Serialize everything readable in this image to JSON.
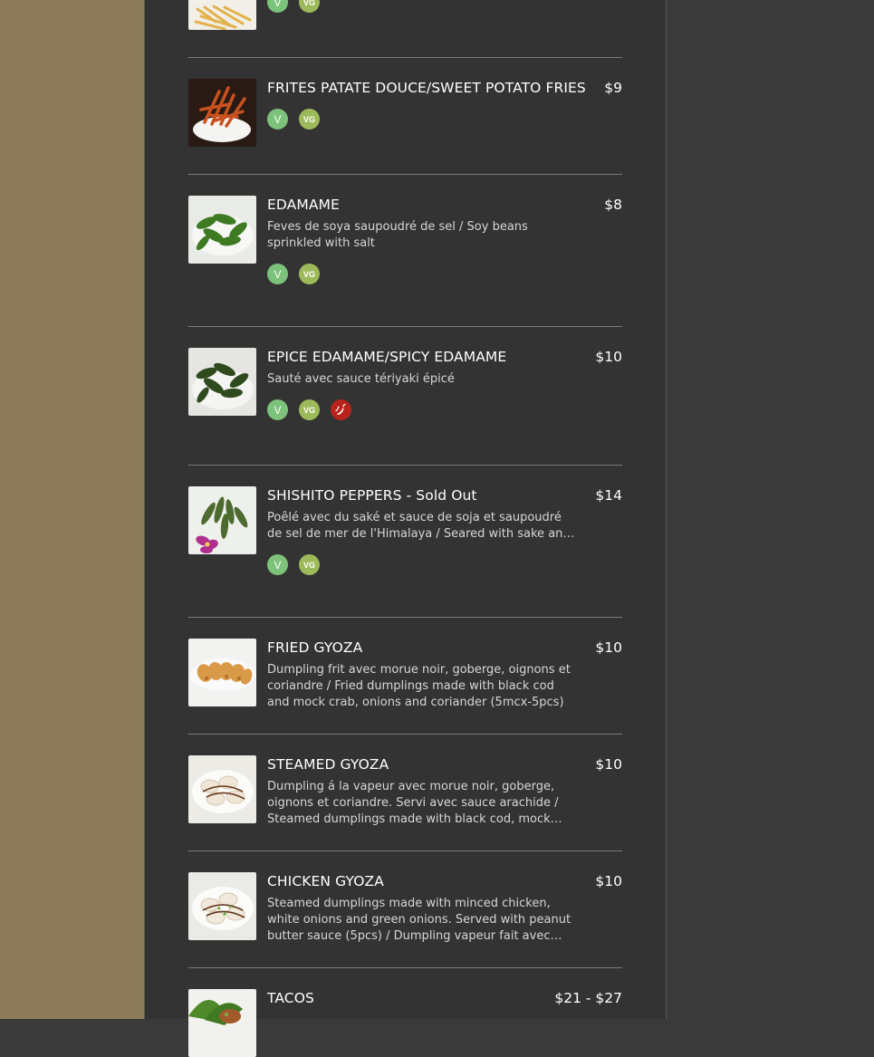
{
  "badges": {
    "v": "V",
    "vg": "VG"
  },
  "colors": {
    "sidebar": "#8b7b59",
    "panel": "#333333",
    "vegan": "#7cc27a",
    "vegetarian": "#9dba5a",
    "spicy": "#b8241c"
  },
  "icons": {
    "spicy": "pepper-icon"
  },
  "items": [
    {
      "name": "",
      "price": "",
      "image": "fries-photo",
      "badges": [
        "V",
        "VG"
      ]
    },
    {
      "name": "FRITES PATATE DOUCE/SWEET POTATO FRIES",
      "price": "$9",
      "image": "sweet-potato-fries-photo",
      "badges": [
        "V",
        "VG"
      ]
    },
    {
      "name": "EDAMAME",
      "price": "$8",
      "description": "Feves de soya saupoudré de sel / Soy beans sprinkled with salt",
      "image": "edamame-photo",
      "badges": [
        "V",
        "VG"
      ]
    },
    {
      "name": "EPICE EDAMAME/SPICY EDAMAME",
      "price": "$10",
      "description": "Sauté avec sauce tériyaki épicé",
      "image": "spicy-edamame-photo",
      "badges": [
        "V",
        "VG",
        "spicy"
      ]
    },
    {
      "name": "SHISHITO PEPPERS - Sold Out",
      "price": "$14",
      "description": "Poêlé avec du saké et sauce de soja et saupoudré de sel de mer de l'Himalaya / Seared with sake and soy sauce",
      "image": "shishito-photo",
      "badges": [
        "V",
        "VG"
      ]
    },
    {
      "name": "FRIED GYOZA",
      "price": "$10",
      "description": "Dumpling frit avec morue noir, goberge, oignons et coriandre / Fried dumplings made with black cod and mock crab, onions and coriander (5mcx-5pcs)",
      "image": "fried-gyoza-photo"
    },
    {
      "name": "STEAMED GYOZA",
      "price": "$10",
      "description": "Dumpling á la vapeur avec morue noir, goberge, oignons et coriandre. Servi avec sauce arachide / Steamed dumplings made with black cod, mock crab, onions and coriander",
      "image": "steamed-gyoza-photo"
    },
    {
      "name": "CHICKEN GYOZA",
      "price": "$10",
      "description": "Steamed dumplings made with minced chicken, white onions and green onions. Served with peanut butter sauce (5pcs) / Dumpling vapeur fait avec poulet, oignons",
      "image": "chicken-gyoza-photo"
    },
    {
      "name": "TACOS",
      "price": "$21 - $27",
      "description": "",
      "image": "tacos-photo"
    }
  ]
}
